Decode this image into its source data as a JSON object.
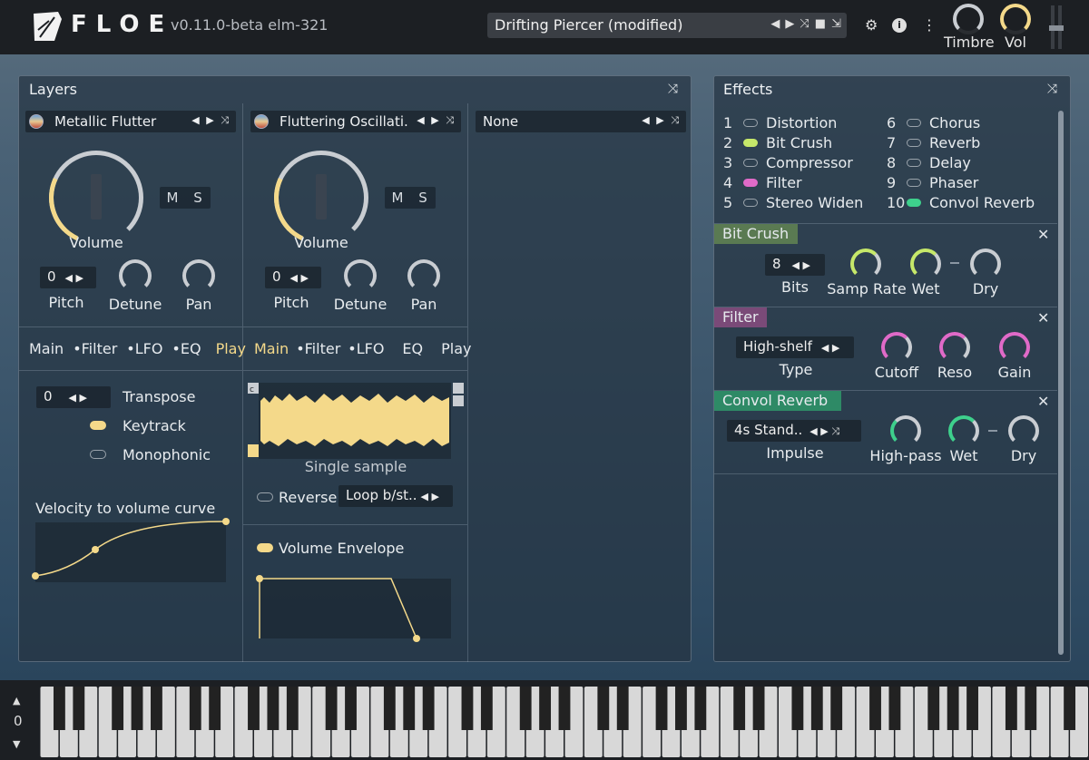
{
  "app": {
    "brand": "FLOE",
    "version": "v0.11.0-beta  elm-321",
    "preset": "Drifting Piercer (modified)",
    "timbre_label": "Timbre",
    "vol_label": "Vol"
  },
  "layers_panel": {
    "title": "Layers",
    "layer1": {
      "instrument": "Metallic Flutter",
      "volume_label": "Volume",
      "m": "M",
      "s": "S",
      "pitch_value": "0",
      "pitch_label": "Pitch",
      "detune_label": "Detune",
      "pan_label": "Pan",
      "tabs": [
        "Main",
        "•Filter",
        "•LFO",
        "•EQ",
        "Play"
      ],
      "active_tab": "Play",
      "transpose_value": "0",
      "transpose_label": "Transpose",
      "keytrack_label": "Keytrack",
      "monophonic_label": "Monophonic",
      "velocity_label": "Velocity to volume curve"
    },
    "layer2": {
      "instrument": "Fluttering Oscillati..",
      "volume_label": "Volume",
      "m": "M",
      "s": "S",
      "pitch_value": "0",
      "pitch_label": "Pitch",
      "detune_label": "Detune",
      "pan_label": "Pan",
      "tabs": [
        "Main",
        "•Filter",
        "•LFO",
        "EQ",
        "Play"
      ],
      "active_tab": "Main",
      "sample_label": "Single sample",
      "reverse_label": "Reverse",
      "loop_value": "Loop b/st..",
      "envelope_label": "Volume Envelope"
    },
    "layer3": {
      "instrument": "None"
    }
  },
  "effects_panel": {
    "title": "Effects",
    "list_left": [
      {
        "num": "1",
        "name": "Distortion",
        "on": false,
        "color": "#9aa3ab"
      },
      {
        "num": "2",
        "name": "Bit Crush",
        "on": true,
        "color": "#c6e86a"
      },
      {
        "num": "3",
        "name": "Compressor",
        "on": false,
        "color": "#9aa3ab"
      },
      {
        "num": "4",
        "name": "Filter",
        "on": true,
        "color": "#e06ac8"
      },
      {
        "num": "5",
        "name": "Stereo Widen",
        "on": false,
        "color": "#9aa3ab"
      }
    ],
    "list_right": [
      {
        "num": "6",
        "name": "Chorus",
        "on": false,
        "color": "#9aa3ab"
      },
      {
        "num": "7",
        "name": "Reverb",
        "on": false,
        "color": "#9aa3ab"
      },
      {
        "num": "8",
        "name": "Delay",
        "on": false,
        "color": "#9aa3ab"
      },
      {
        "num": "9",
        "name": "Phaser",
        "on": false,
        "color": "#9aa3ab"
      },
      {
        "num": "10",
        "name": "Convol Reverb",
        "on": true,
        "color": "#3ed08c"
      }
    ],
    "bitcrush": {
      "title": "Bit Crush",
      "bits_value": "8",
      "bits_label": "Bits",
      "samp_rate_label": "Samp Rate",
      "wet_label": "Wet",
      "dry_label": "Dry",
      "color": "#c6e86a"
    },
    "filter": {
      "title": "Filter",
      "type_value": "High-shelf",
      "type_label": "Type",
      "cutoff_label": "Cutoff",
      "reso_label": "Reso",
      "gain_label": "Gain",
      "color": "#e06ac8"
    },
    "convol": {
      "title": "Convol Reverb",
      "impulse_value": "4s Stand..",
      "impulse_label": "Impulse",
      "highpass_label": "High-pass",
      "wet_label": "Wet",
      "dry_label": "Dry",
      "color": "#3ed08c"
    }
  },
  "keyboard": {
    "octave_value": "0"
  },
  "colors": {
    "accent": "#f4d98a",
    "topbar": "#1c1f23"
  }
}
